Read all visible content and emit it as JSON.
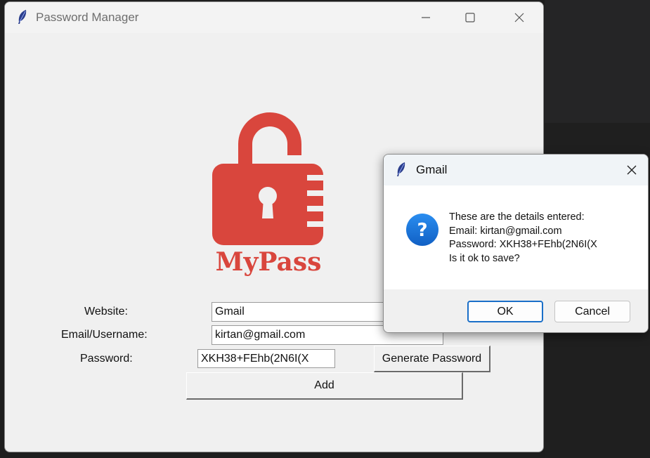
{
  "main_window": {
    "title": "Password Manager",
    "logo_text": "MyPass",
    "logo_color": "#d9463d",
    "form": {
      "website_label": "Website:",
      "website_value": "Gmail",
      "email_label": "Email/Username:",
      "email_value": "kirtan@gmail.com",
      "password_label": "Password:",
      "password_value": "XKH38+FEhb(2N6I(X",
      "generate_button": "Generate Password",
      "add_button": "Add"
    }
  },
  "dialog": {
    "title": "Gmail",
    "icon": "question-icon",
    "message_lines": [
      "These are the details entered:",
      "Email: kirtan@gmail.com",
      "Password: XKH38+FEhb(2N6I(X",
      "Is it ok to save?"
    ],
    "ok_button": "OK",
    "cancel_button": "Cancel",
    "accent_color": "#1a6fc8"
  }
}
